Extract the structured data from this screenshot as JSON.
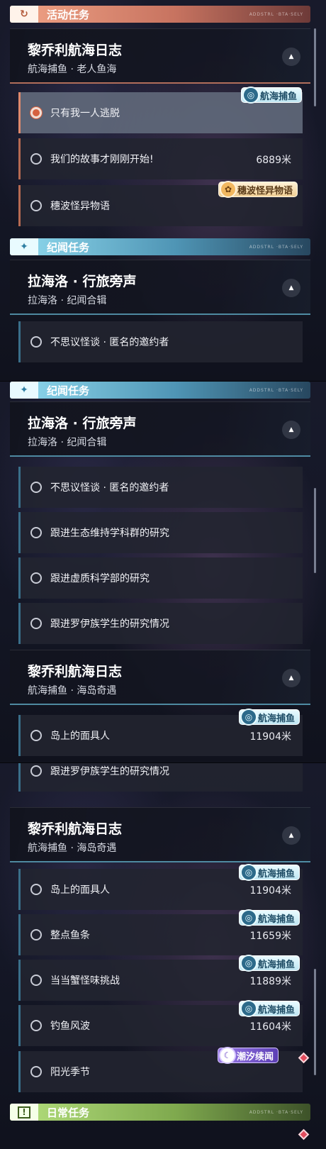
{
  "panel1": {
    "cat_activity": {
      "icon": "activity-icon",
      "label": "活动任务",
      "deco": "ADDSTRL ·BTA·SELY"
    },
    "group_lijoli_1": {
      "title": "黎乔利航海日志",
      "subtitle": "航海捕鱼 · 老人鱼海",
      "toggle": "▲"
    },
    "row_escape": {
      "title": "只有我一人逃脱",
      "badge": "航海捕鱼",
      "badge_icon": "fish-badge-icon"
    },
    "row_story": {
      "title": "我们的故事才刚刚开始!",
      "distance": "6889米"
    },
    "row_wave": {
      "title": "穗波怪异物语",
      "badge": "穗波怪异物语",
      "badge_icon": "wave-badge-icon"
    },
    "cat_lore": {
      "icon": "sparkle-icon",
      "label": "纪闻任务",
      "deco": "ADDSTRL ·BTA·SELY"
    },
    "group_lahailuo": {
      "title": "拉海洛 · 行旅旁声",
      "subtitle": "拉海洛 · 纪闻合辑",
      "toggle": "▲"
    },
    "row_mystery": {
      "title": "不思议怪谈 · 匿名的邀约者"
    }
  },
  "panel2": {
    "cat_lore": {
      "icon": "sparkle-icon",
      "label": "纪闻任务",
      "deco": "ADDSTRL ·BTA·SELY"
    },
    "group_lahailuo": {
      "title": "拉海洛 · 行旅旁声",
      "subtitle": "拉海洛 · 纪闻合辑",
      "toggle": "▲"
    },
    "rows": [
      {
        "title": "不思议怪谈 · 匿名的邀约者"
      },
      {
        "title": "跟进生态维持学科群的研究"
      },
      {
        "title": "跟进虚质科学部的研究"
      },
      {
        "title": "跟进罗伊族学生的研究情况"
      }
    ],
    "group_lijoli_2": {
      "title": "黎乔利航海日志",
      "subtitle": "航海捕鱼 · 海岛奇遇",
      "toggle": "▲"
    },
    "row_island": {
      "title": "岛上的面具人",
      "distance": "11904米",
      "badge": "航海捕鱼"
    }
  },
  "panel3": {
    "row_roi": {
      "title": "跟进罗伊族学生的研究情况"
    },
    "group_lijoli_2": {
      "title": "黎乔利航海日志",
      "subtitle": "航海捕鱼 · 海岛奇遇",
      "toggle": "▲"
    },
    "rows": [
      {
        "title": "岛上的面具人",
        "distance": "11904米",
        "badge": "航海捕鱼"
      },
      {
        "title": "整点鱼条",
        "distance": "11659米",
        "badge": "航海捕鱼"
      },
      {
        "title": "当当蟹怪味挑战",
        "distance": "11889米",
        "badge": "航海捕鱼"
      },
      {
        "title": "钓鱼风波",
        "distance": "11604米",
        "badge": "航海捕鱼"
      }
    ],
    "row_sunshine": {
      "title": "阳光季节",
      "badge": "潮汐续闻",
      "badge_icon": "tide-badge-icon"
    },
    "cat_daily": {
      "icon": "exclamation-icon",
      "label": "日常任务",
      "deco": "ADDSTRL ·BTA·SELY"
    }
  },
  "colors": {
    "activity_accent": "#f2a487",
    "lore_accent": "#92dcf0",
    "daily_accent": "#b5e07e",
    "selected_dot": "#d6613f",
    "alert_diamond": "#e24d5e"
  }
}
